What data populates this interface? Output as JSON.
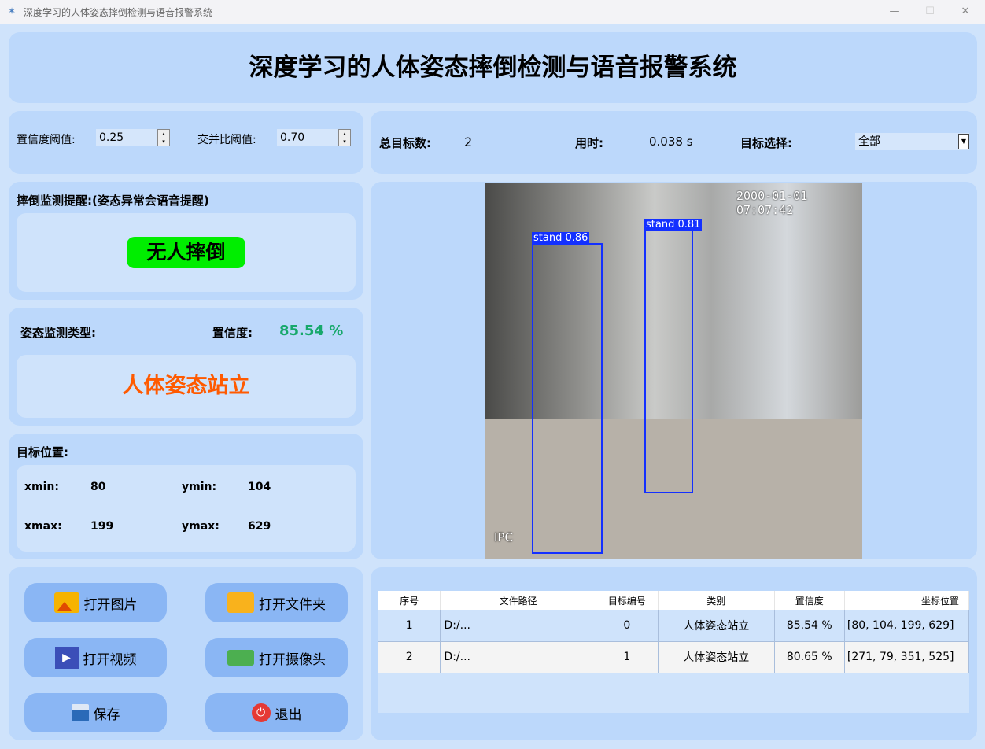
{
  "window": {
    "title": "深度学习的人体姿态摔倒检测与语音报警系统",
    "min": "—",
    "max": "☐",
    "close": "✕"
  },
  "header": {
    "title": "深度学习的人体姿态摔倒检测与语音报警系统"
  },
  "params": {
    "conf_label": "置信度阈值:",
    "conf_value": "0.25",
    "iou_label": "交并比阈值:",
    "iou_value": "0.70"
  },
  "stats": {
    "total_label": "总目标数:",
    "total_value": "2",
    "time_label": "用时:",
    "time_value": "0.038 s",
    "select_label": "目标选择:",
    "select_value": "全部"
  },
  "fall": {
    "label": "摔倒监测提醒:(姿态异常会语音提醒)",
    "status": "无人摔倒",
    "status_color": "#00ee00"
  },
  "pose": {
    "type_label": "姿态监测类型:",
    "conf_label": "置信度:",
    "conf_value": "85.54 %",
    "result": "人体姿态站立",
    "result_color": "#ff5a00"
  },
  "position": {
    "label": "目标位置:",
    "xmin_label": "xmin:",
    "xmin": "80",
    "ymin_label": "ymin:",
    "ymin": "104",
    "xmax_label": "xmax:",
    "xmax": "199",
    "ymax_label": "ymax:",
    "ymax": "629"
  },
  "image": {
    "timestamp": "2000-01-01 07:07:42",
    "watermark": "IPC",
    "boxes": [
      {
        "label": "stand 0.86"
      },
      {
        "label": "stand 0.81"
      }
    ]
  },
  "buttons": {
    "open_image": "打开图片",
    "open_folder": "打开文件夹",
    "open_video": "打开视频",
    "open_camera": "打开摄像头",
    "save": "保存",
    "exit": "退出"
  },
  "table": {
    "headers": [
      "序号",
      "文件路径",
      "目标编号",
      "类别",
      "置信度",
      "坐标位置"
    ],
    "rows": [
      [
        "1",
        "D:/...",
        "0",
        "人体姿态站立",
        "85.54 %",
        "[80, 104, 199, 629]"
      ],
      [
        "2",
        "D:/...",
        "1",
        "人体姿态站立",
        "80.65 %",
        "[271, 79, 351, 525]"
      ]
    ]
  }
}
